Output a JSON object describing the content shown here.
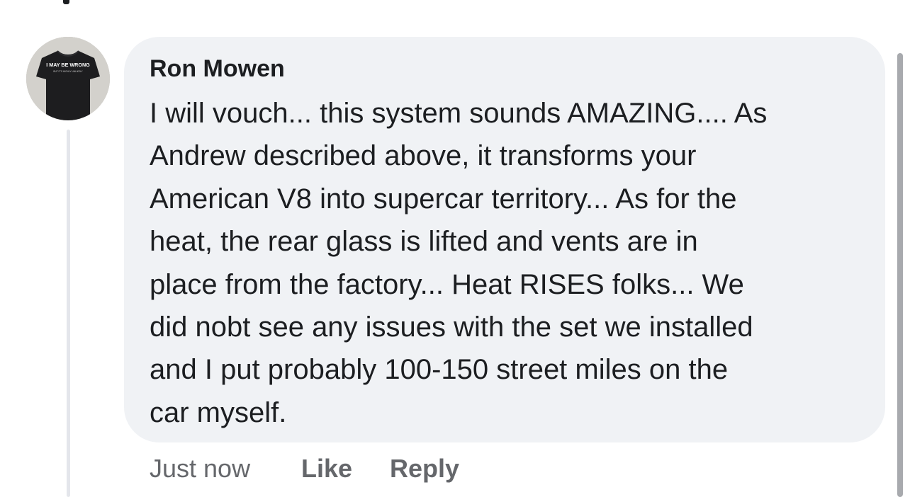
{
  "comment": {
    "author": "Ron Mowen",
    "lines": [
      "I will vouch... this system sounds AMAZING.... As",
      "Andrew described above, it transforms your",
      "American V8 into supercar territory... As for the",
      "heat, the rear glass is lifted and vents are in",
      "place from the factory... Heat RISES folks... We",
      "did nobt see any issues with the set we installed",
      "and I put probably 100-150 street miles on the",
      "car myself."
    ],
    "avatar": {
      "icon": "t-shirt-icon",
      "shirt_text": "I MAY BE WRONG",
      "shirt_subtext": "BUT IT'S HIGHLY UNLIKELY"
    }
  },
  "actions": {
    "time": "Just now",
    "like_label": "Like",
    "reply_label": "Reply"
  },
  "colors": {
    "bubble": "#f0f2f5",
    "text": "#1c1e21",
    "meta": "#65676b"
  }
}
